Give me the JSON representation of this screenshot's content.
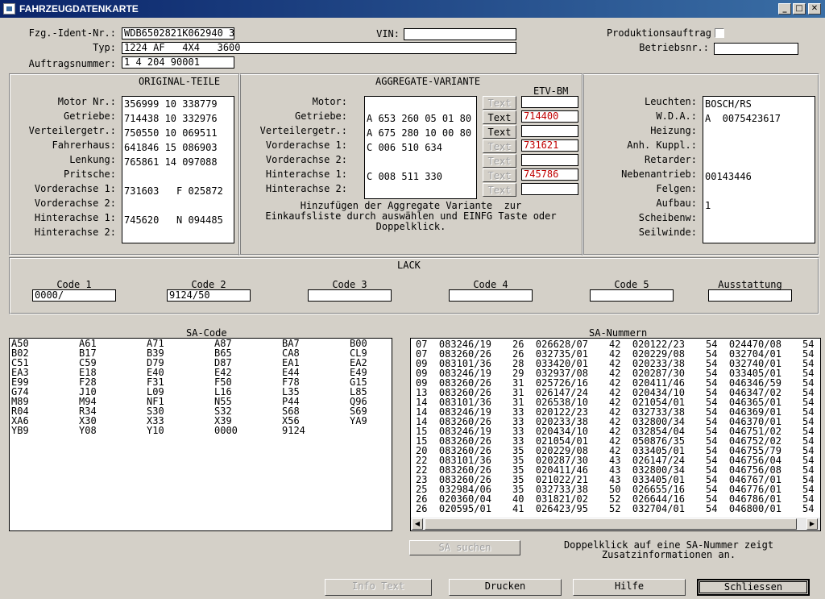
{
  "window": {
    "title": "FAHRZEUGDATENKARTE",
    "min": "_",
    "max": "□",
    "close": "✕"
  },
  "header": {
    "fzg_label": "Fzg.-Ident-Nr.:",
    "fzg_value": "WDB6502821K062940 3",
    "typ_label": "Typ:",
    "typ_value": "1224 AF   4X4   3600",
    "auftrag_label": "Auftragsnummer:",
    "auftrag_value": "1 4 204 90001",
    "vin_label": "VIN:",
    "vin_value": "",
    "prod_label": "Produktionsauftrag",
    "betrieb_label": "Betriebsnr.:",
    "betrieb_value": ""
  },
  "original": {
    "title": "ORIGINAL-TEILE",
    "labels": [
      "Motor Nr.:",
      "Getriebe:",
      "Verteilergetr.:",
      "Fahrerhaus:",
      "Lenkung:",
      "Pritsche:",
      "Vorderachse 1:",
      "Vorderachse 2:",
      "Hinterachse 1:",
      "Hinterachse 2:"
    ],
    "values": [
      "356999 10 338779",
      "714438 10 332976",
      "750550 10 069511",
      "641846 15 086903",
      "765861 14 097088",
      "",
      "731603   F 025872",
      "",
      "745620   N 094485",
      ""
    ]
  },
  "aggregate": {
    "title": "AGGREGATE-VARIANTE",
    "etv_title": "ETV-BM",
    "labels": [
      "Motor:",
      "Getriebe:",
      "Verteilergetr.:",
      "Vorderachse 1:",
      "Vorderachse 2:",
      "Hinterachse 1:",
      "Hinterachse 2:"
    ],
    "values": [
      "",
      "A 653 260 05 01 80",
      "A 675 280 10 00 80",
      "C 006 510 634",
      "",
      "C 008 511 330",
      ""
    ],
    "text_buttons": [
      "Text",
      "Text",
      "Text",
      "Text",
      "Text",
      "Text",
      "Text"
    ],
    "etv": [
      "",
      "714400",
      "",
      "731621",
      "",
      "745786",
      ""
    ],
    "hint_1": "Hinzufügen der Aggregate Variante  zur",
    "hint_2": "Einkaufsliste durch auswählen und EINFG Taste oder",
    "hint_3": "Doppelklick."
  },
  "right_panel": {
    "labels": [
      "Leuchten:",
      "W.D.A.:",
      "Heizung:",
      "Anh. Kuppl.:",
      "Retarder:",
      "Nebenantrieb:",
      "Felgen:",
      "Aufbau:",
      "Scheibenw:",
      "Seilwinde:"
    ],
    "values": [
      "BOSCH/RS",
      "A  0075423617",
      "",
      "",
      "",
      "00143446",
      "",
      "1",
      "",
      ""
    ]
  },
  "lack": {
    "title": "LACK",
    "labels": [
      "Code 1",
      "Code 2",
      "Code 3",
      "Code 4",
      "Code 5",
      "Ausstattung"
    ],
    "values": [
      "0000/",
      "9124/50",
      "",
      "",
      "",
      ""
    ]
  },
  "sa_code": {
    "title": "SA-Code",
    "rows": [
      [
        "A50",
        "A61",
        "A71",
        "A87",
        "BA7",
        "B00"
      ],
      [
        "B02",
        "B17",
        "B39",
        "B65",
        "CA8",
        "CL9"
      ],
      [
        "C51",
        "C59",
        "D79",
        "D87",
        "EA1",
        "EA2"
      ],
      [
        "EA3",
        "E18",
        "E40",
        "E42",
        "E44",
        "E49"
      ],
      [
        "E99",
        "F28",
        "F31",
        "F50",
        "F78",
        "G15"
      ],
      [
        "G74",
        "J10",
        "L09",
        "L16",
        "L35",
        "L85"
      ],
      [
        "M89",
        "M94",
        "NF1",
        "N55",
        "P44",
        "Q96"
      ],
      [
        "R04",
        "R34",
        "S30",
        "S32",
        "S68",
        "S69"
      ],
      [
        "XA6",
        "X30",
        "X33",
        "X39",
        "X56",
        "YA9"
      ],
      [
        "YB9",
        "Y08",
        "Y10",
        "0000",
        "9124",
        ""
      ]
    ]
  },
  "sa_nummern": {
    "title": "SA-Nummern",
    "rows": [
      [
        "07  083246/19",
        "26  026628/07",
        "42  020122/23",
        "54  024470/08",
        "54"
      ],
      [
        "07  083260/26",
        "26  032735/01",
        "42  020229/08",
        "54  032704/01",
        "54"
      ],
      [
        "09  083101/36",
        "28  033420/01",
        "42  020233/38",
        "54  032740/01",
        "54"
      ],
      [
        "09  083246/19",
        "29  032937/08",
        "42  020287/30",
        "54  033405/01",
        "54"
      ],
      [
        "09  083260/26",
        "31  025726/16",
        "42  020411/46",
        "54  046346/59",
        "54"
      ],
      [
        "13  083260/26",
        "31  026147/24",
        "42  020434/10",
        "54  046347/02",
        "54"
      ],
      [
        "14  083101/36",
        "31  026538/10",
        "42  021054/01",
        "54  046365/01",
        "54"
      ],
      [
        "14  083246/19",
        "33  020122/23",
        "42  032733/38",
        "54  046369/01",
        "54"
      ],
      [
        "14  083260/26",
        "33  020233/38",
        "42  032800/34",
        "54  046370/01",
        "54"
      ],
      [
        "15  083246/19",
        "33  020434/10",
        "42  032854/04",
        "54  046751/02",
        "54"
      ],
      [
        "15  083260/26",
        "33  021054/01",
        "42  050876/35",
        "54  046752/02",
        "54"
      ],
      [
        "20  083260/26",
        "35  020229/08",
        "42  033405/01",
        "54  046755/79",
        "54"
      ],
      [
        "22  083101/36",
        "35  020287/30",
        "43  026147/24",
        "54  046756/04",
        "54"
      ],
      [
        "22  083260/26",
        "35  020411/46",
        "43  032800/34",
        "54  046756/08",
        "54"
      ],
      [
        "23  083260/26",
        "35  021022/21",
        "43  033405/01",
        "54  046767/01",
        "54"
      ],
      [
        "25  032984/06",
        "35  032733/38",
        "50  026655/16",
        "54  046776/01",
        "54"
      ],
      [
        "26  020360/04",
        "40  031821/02",
        "52  026644/16",
        "54  046786/01",
        "54"
      ],
      [
        "26  020595/01",
        "41  026423/95",
        "52  032704/01",
        "54  046800/01",
        "54"
      ]
    ]
  },
  "sa_search_button": "SA suchen",
  "sa_hint_1": "Doppelklick auf eine SA-Nummer zeigt",
  "sa_hint_2": "Zusatzinformationen an.",
  "footer": {
    "info": "Info Text",
    "print": "Drucken",
    "help": "Hilfe",
    "close": "Schliessen"
  }
}
